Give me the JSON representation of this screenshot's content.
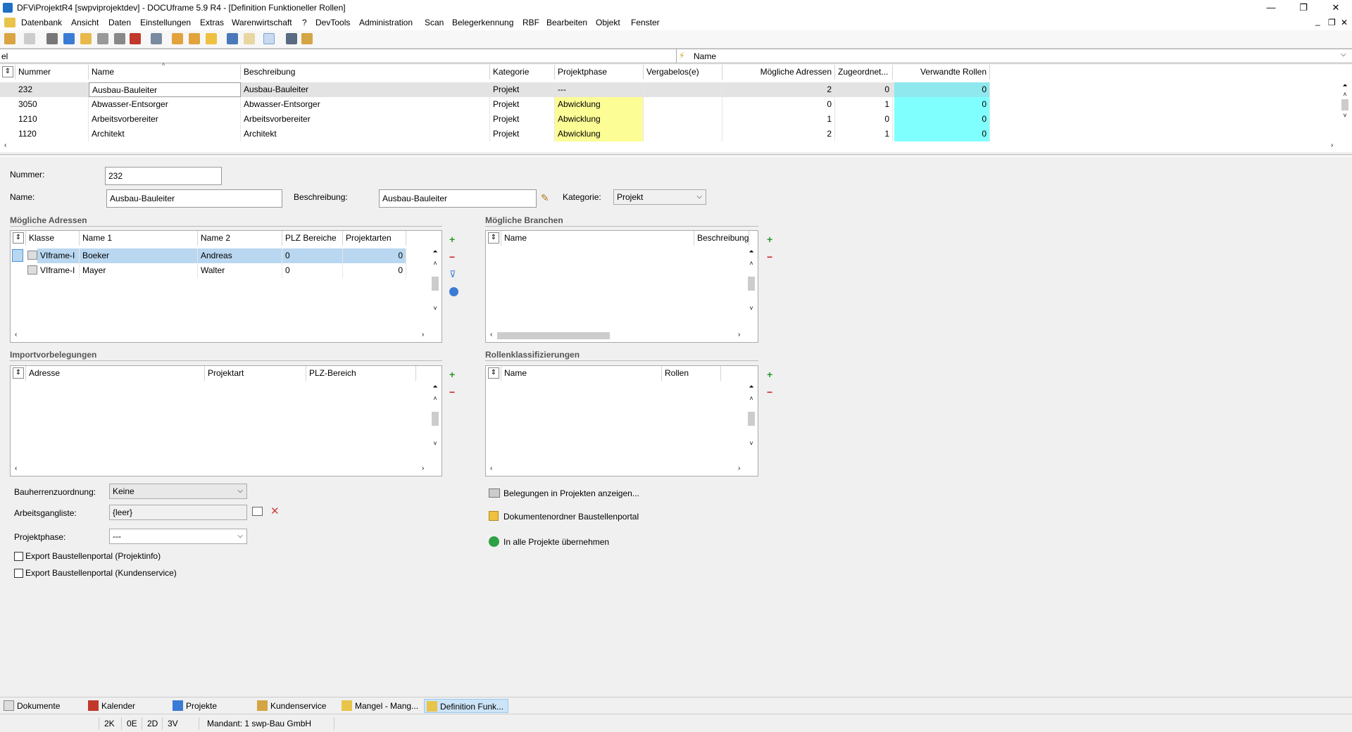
{
  "window": {
    "title": "DFViProjektR4 [swpviprojektdev] - DOCUframe 5.9 R4 - [Definition Funktioneller Rollen]",
    "controls": {
      "minimize": "—",
      "restore": "❐",
      "close": "✕"
    },
    "mdi_controls": {
      "minimize": "_",
      "restore": "❐",
      "close": "✕"
    }
  },
  "menu": [
    "Datenbank",
    "Ansicht",
    "Daten",
    "Einstellungen",
    "Extras",
    "Warenwirtschaft",
    "?",
    "DevTools",
    "Administration",
    "Scan",
    "Belegerkennung",
    "RBF",
    "Bearbeiten",
    "Objekt",
    "Fenster"
  ],
  "filter": {
    "value": "el",
    "field_label": "Name"
  },
  "main_grid": {
    "columns": [
      "Nummer",
      "Name",
      "Beschreibung",
      "Kategorie",
      "Projektphase",
      "Vergabelos(e)",
      "Mögliche Adressen",
      "Zugeordnet...",
      "Verwandte Rollen"
    ],
    "rows": [
      {
        "nummer": "232",
        "name": "Ausbau-Bauleiter",
        "beschreibung": "Ausbau-Bauleiter",
        "kategorie": "Projekt",
        "phase": "---",
        "vergabelos": "",
        "adressen": "2",
        "zugeordnet": "0",
        "rollen": "0"
      },
      {
        "nummer": "3050",
        "name": "Abwasser-Entsorger",
        "beschreibung": "Abwasser-Entsorger",
        "kategorie": "Projekt",
        "phase": "Abwicklung",
        "vergabelos": "",
        "adressen": "0",
        "zugeordnet": "1",
        "rollen": "0"
      },
      {
        "nummer": "1210",
        "name": "Arbeitsvorbereiter",
        "beschreibung": "Arbeitsvorbereiter",
        "kategorie": "Projekt",
        "phase": "Abwicklung",
        "vergabelos": "",
        "adressen": "1",
        "zugeordnet": "0",
        "rollen": "0"
      },
      {
        "nummer": "1120",
        "name": "Architekt",
        "beschreibung": "Architekt",
        "kategorie": "Projekt",
        "phase": "Abwicklung",
        "vergabelos": "",
        "adressen": "2",
        "zugeordnet": "1",
        "rollen": "0"
      }
    ]
  },
  "detail": {
    "nummer_label": "Nummer:",
    "nummer_value": "232",
    "name_label": "Name:",
    "name_value": "Ausbau-Bauleiter",
    "beschreibung_label": "Beschreibung:",
    "beschreibung_value": "Ausbau-Bauleiter",
    "kategorie_label": "Kategorie:",
    "kategorie_value": "Projekt"
  },
  "adressen": {
    "title": "Mögliche Adressen",
    "columns": [
      "Klasse",
      "Name 1",
      "Name 2",
      "PLZ Bereiche",
      "Projektarten"
    ],
    "rows": [
      {
        "klasse": "VIframe-I",
        "name1": "Boeker",
        "name2": "Andreas",
        "plz": "0",
        "arten": "0"
      },
      {
        "klasse": "VIframe-I",
        "name1": "Mayer",
        "name2": "Walter",
        "plz": "0",
        "arten": "0"
      }
    ]
  },
  "branchen": {
    "title": "Mögliche Branchen",
    "columns": [
      "Name",
      "Beschreibung"
    ]
  },
  "import": {
    "title": "Importvorbelegungen",
    "columns": [
      "Adresse",
      "Projektart",
      "PLZ-Bereich"
    ]
  },
  "klass": {
    "title": "Rollenklassifizierungen",
    "columns": [
      "Name",
      "Rollen"
    ]
  },
  "options": {
    "bauherr_label": "Bauherrenzuordnung:",
    "bauherr_value": "Keine",
    "arbeitsgang_label": "Arbeitsgangliste:",
    "arbeitsgang_value": "{leer}",
    "phase_label": "Projektphase:",
    "phase_value": "---",
    "export1": "Export Baustellenportal (Projektinfo)",
    "export2": "Export Baustellenportal (Kundenservice)"
  },
  "actions": {
    "belegungen": "Belegungen in Projekten anzeigen...",
    "dokumentenordner": "Dokumentenordner Baustellenportal",
    "uebernehmen": "In alle Projekte übernehmen"
  },
  "tabs": [
    "Dokumente",
    "Kalender",
    "Projekte",
    "Kundenservice",
    "Mangel - Mang...",
    "Definition Funk..."
  ],
  "status": {
    "k": "2K",
    "e": "0E",
    "d": "2D",
    "v": "3V",
    "mandant": "Mandant: 1 swp-Bau GmbH"
  },
  "colors": {
    "highlight_yellow": "#fdfd96",
    "highlight_cyan": "#80ffff",
    "selected_row": "#e3e3e3",
    "selected_cell": "#b9d7f0",
    "accent_blue": "#1f6fc5"
  }
}
